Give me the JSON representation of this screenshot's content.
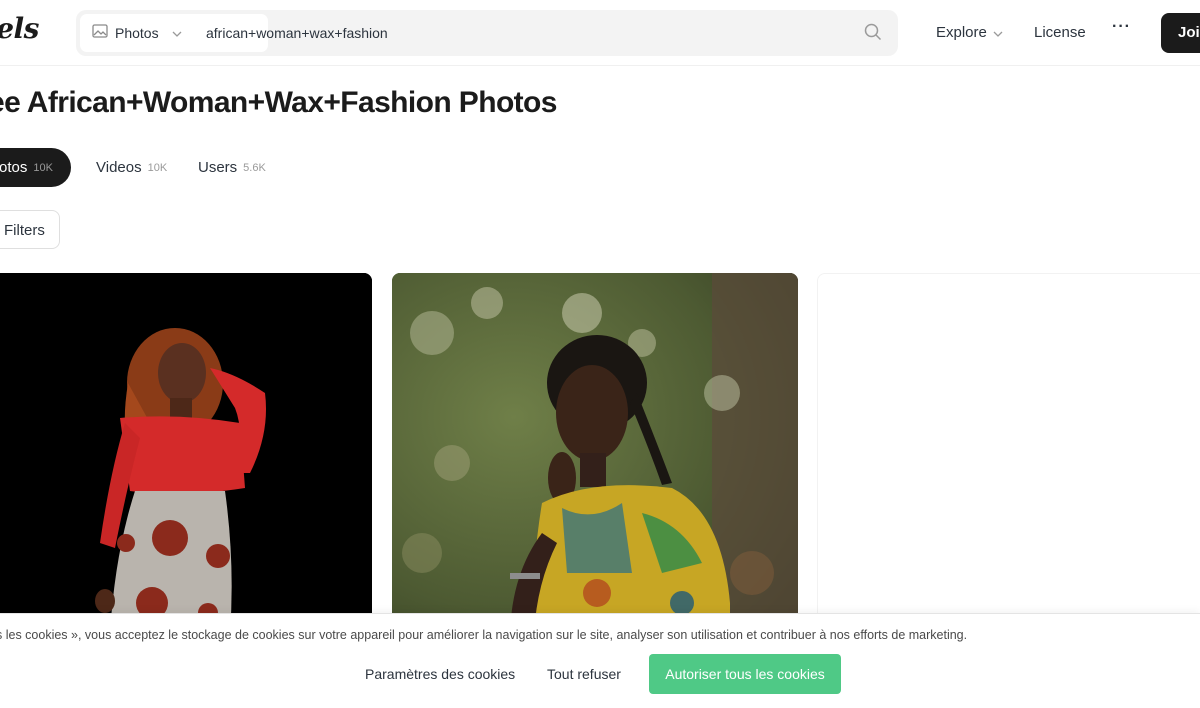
{
  "header": {
    "logo_text": "xels",
    "search": {
      "type_label": "Photos",
      "query": "african+woman+wax+fashion"
    },
    "nav": {
      "explore": "Explore",
      "license": "License",
      "more": "···",
      "join": "Join"
    }
  },
  "main": {
    "title": "ee African+Woman+Wax+Fashion Photos",
    "tabs": [
      {
        "label": "otos",
        "count": "10K"
      },
      {
        "label": "Videos",
        "count": "10K"
      },
      {
        "label": "Users",
        "count": "5.6K"
      }
    ],
    "filters_label": "Filters"
  },
  "cookies": {
    "text": "s les cookies », vous acceptez le stockage de cookies sur votre appareil pour améliorer la navigation sur le site, analyser son utilisation et contribuer à nos efforts de marketing.",
    "settings": "Paramètres des cookies",
    "refuse": "Tout refuser",
    "accept": "Autoriser tous les cookies"
  },
  "colors": {
    "accent_green": "#4fc986",
    "dark": "#1b1b1b"
  }
}
